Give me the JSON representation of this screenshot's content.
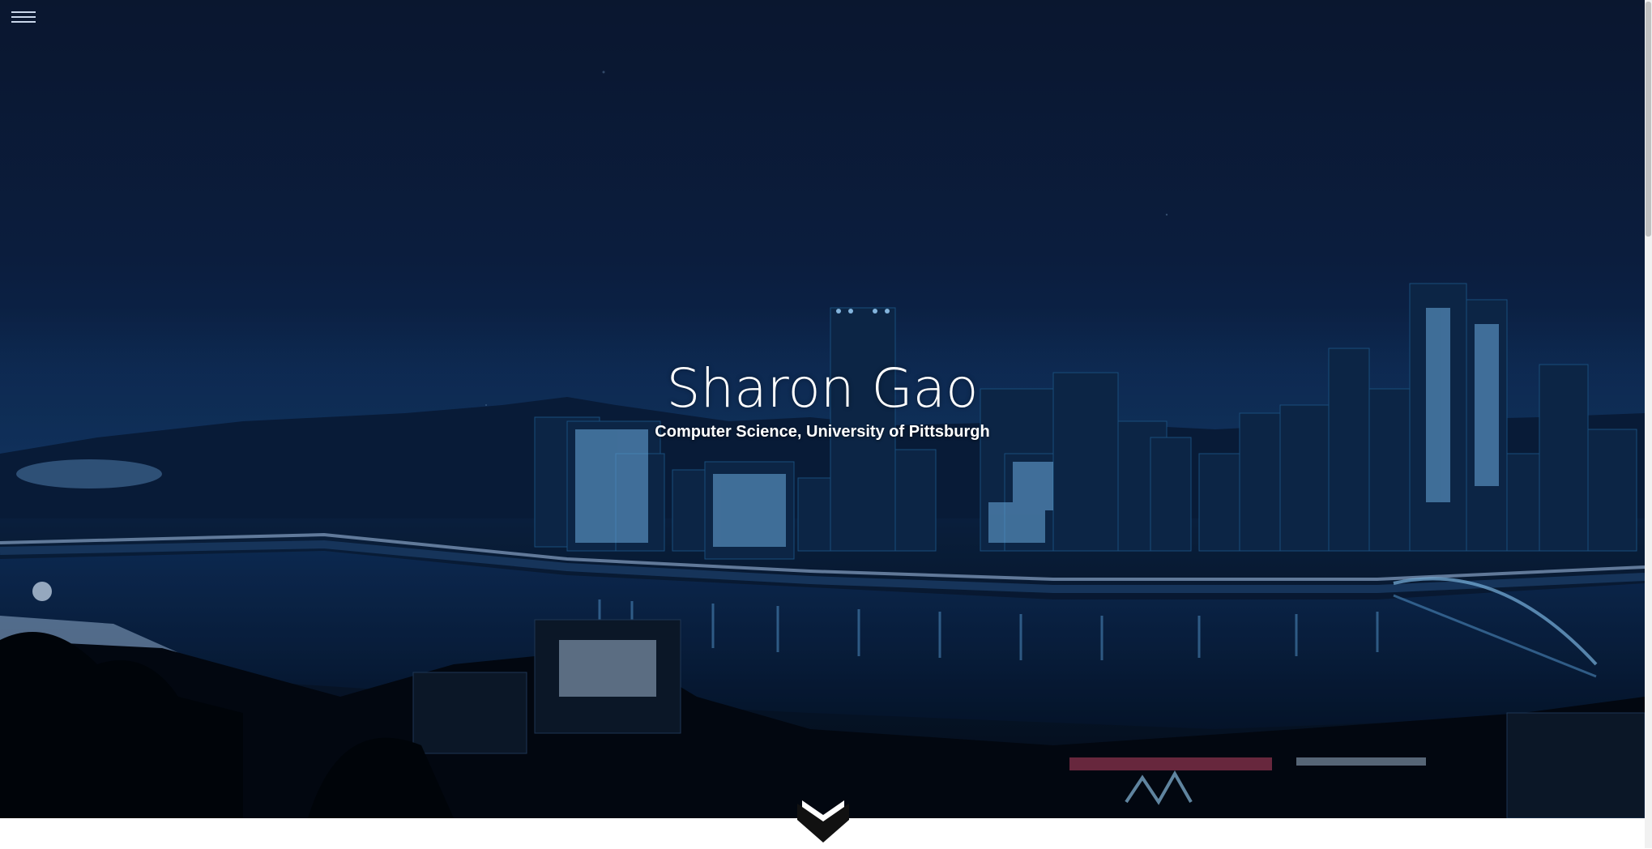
{
  "page": {
    "name": "Sharon Gao",
    "subtitle": "Computer Science, University of Pittsburgh"
  },
  "icons": {
    "menu": "hamburger-menu-icon",
    "scroll_down": "chevron-down-icon"
  },
  "colors": {
    "hero_top": "#0c1a33",
    "hero_mid": "#0e2a52",
    "city_lights": "#5fb6ff",
    "text": "#ffffff",
    "below_fold": "#ffffff"
  }
}
